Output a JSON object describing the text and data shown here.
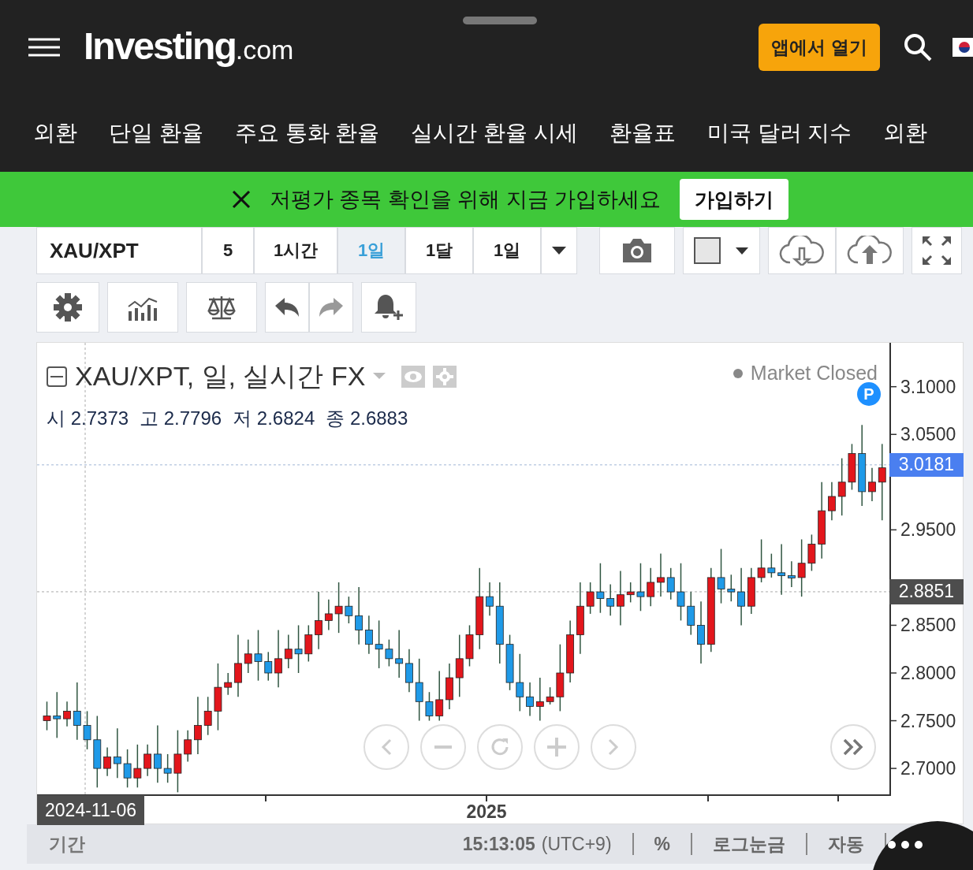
{
  "header": {
    "logo_main": "Investing",
    "logo_suffix": ".com",
    "open_app_button": "앱에서 열기"
  },
  "nav": [
    "외환",
    "단일 환율",
    "주요 통화 환율",
    "실시간 환율 시세",
    "환율표",
    "미국 달러 지수",
    "외환"
  ],
  "banner": {
    "message": "저평가 종목 확인을 위해 지금 가입하세요",
    "signup_button": "가입하기"
  },
  "toolbar": {
    "symbol": "XAU/XPT",
    "intervals": [
      {
        "label": "5",
        "selected": false
      },
      {
        "label": "1시간",
        "selected": false
      },
      {
        "label": "1일",
        "selected": true
      },
      {
        "label": "1달",
        "selected": false
      },
      {
        "label": "1일",
        "selected": false
      }
    ]
  },
  "chart": {
    "title": "XAU/XPT, 일, 실시간 FX",
    "market_status": "Market Closed",
    "p_badge": "P",
    "ohlc_legend": [
      {
        "label": "시",
        "value": "2.7373"
      },
      {
        "label": "고",
        "value": "2.7796"
      },
      {
        "label": "저",
        "value": "2.6824"
      },
      {
        "label": "종",
        "value": "2.6883"
      }
    ],
    "current_price": "3.0181",
    "crosshair_price": "2.8851",
    "crosshair_date": "2024-11-06",
    "time_axis_labels": [
      "2025"
    ],
    "chart_data": {
      "type": "candlestick",
      "ylim": [
        2.672,
        3.146
      ],
      "yticks": [
        {
          "value": 3.1,
          "label": "3.1000"
        },
        {
          "value": 3.05,
          "label": "3.0500"
        },
        {
          "value": 2.95,
          "label": "2.9500"
        },
        {
          "value": 2.85,
          "label": "2.8500"
        },
        {
          "value": 2.8,
          "label": "2.8000"
        },
        {
          "value": 2.75,
          "label": "2.7500"
        },
        {
          "value": 2.7,
          "label": "2.7000"
        }
      ],
      "ref_lines": [
        {
          "axis": "y",
          "value": 3.0181,
          "color": "#9fb5d6"
        },
        {
          "axis": "y",
          "value": 2.8851,
          "color": "#aaaaaa"
        }
      ],
      "ohlc": [
        [
          2.75,
          2.77,
          2.74,
          2.755
        ],
        [
          2.755,
          2.78,
          2.732,
          2.752
        ],
        [
          2.752,
          2.77,
          2.744,
          2.76
        ],
        [
          2.76,
          2.79,
          2.73,
          2.745
        ],
        [
          2.745,
          2.76,
          2.72,
          2.73
        ],
        [
          2.73,
          2.755,
          2.68,
          2.7
        ],
        [
          2.7,
          2.722,
          2.692,
          2.712
        ],
        [
          2.712,
          2.742,
          2.69,
          2.705
        ],
        [
          2.705,
          2.72,
          2.68,
          2.69
        ],
        [
          2.69,
          2.725,
          2.68,
          2.7
        ],
        [
          2.7,
          2.725,
          2.692,
          2.715
        ],
        [
          2.715,
          2.745,
          2.685,
          2.7
        ],
        [
          2.7,
          2.715,
          2.685,
          2.695
        ],
        [
          2.695,
          2.74,
          2.675,
          2.715
        ],
        [
          2.715,
          2.74,
          2.707,
          2.73
        ],
        [
          2.73,
          2.775,
          2.715,
          2.745
        ],
        [
          2.745,
          2.775,
          2.735,
          2.76
        ],
        [
          2.76,
          2.81,
          2.74,
          2.785
        ],
        [
          2.785,
          2.8,
          2.777,
          2.79
        ],
        [
          2.79,
          2.84,
          2.775,
          2.81
        ],
        [
          2.81,
          2.835,
          2.8,
          2.82
        ],
        [
          2.82,
          2.845,
          2.792,
          2.812
        ],
        [
          2.812,
          2.822,
          2.792,
          2.8
        ],
        [
          2.8,
          2.845,
          2.785,
          2.815
        ],
        [
          2.815,
          2.84,
          2.805,
          2.825
        ],
        [
          2.825,
          2.85,
          2.8,
          2.82
        ],
        [
          2.82,
          2.85,
          2.812,
          2.84
        ],
        [
          2.84,
          2.885,
          2.825,
          2.855
        ],
        [
          2.855,
          2.877,
          2.845,
          2.862
        ],
        [
          2.862,
          2.895,
          2.842,
          2.87
        ],
        [
          2.87,
          2.88,
          2.852,
          2.86
        ],
        [
          2.86,
          2.89,
          2.83,
          2.845
        ],
        [
          2.845,
          2.86,
          2.82,
          2.83
        ],
        [
          2.83,
          2.855,
          2.805,
          2.825
        ],
        [
          2.825,
          2.835,
          2.807,
          2.815
        ],
        [
          2.815,
          2.845,
          2.795,
          2.81
        ],
        [
          2.81,
          2.825,
          2.78,
          2.79
        ],
        [
          2.79,
          2.815,
          2.75,
          2.77
        ],
        [
          2.77,
          2.78,
          2.75,
          2.755
        ],
        [
          2.755,
          2.802,
          2.75,
          2.772
        ],
        [
          2.772,
          2.81,
          2.762,
          2.795
        ],
        [
          2.795,
          2.84,
          2.775,
          2.815
        ],
        [
          2.815,
          2.85,
          2.807,
          2.84
        ],
        [
          2.84,
          2.91,
          2.825,
          2.88
        ],
        [
          2.88,
          2.895,
          2.86,
          2.87
        ],
        [
          2.87,
          2.895,
          2.81,
          2.83
        ],
        [
          2.83,
          2.84,
          2.782,
          2.79
        ],
        [
          2.79,
          2.82,
          2.76,
          2.775
        ],
        [
          2.775,
          2.79,
          2.755,
          2.765
        ],
        [
          2.765,
          2.795,
          2.75,
          2.77
        ],
        [
          2.77,
          2.785,
          2.767,
          2.775
        ],
        [
          2.775,
          2.83,
          2.76,
          2.8
        ],
        [
          2.8,
          2.855,
          2.79,
          2.84
        ],
        [
          2.84,
          2.895,
          2.82,
          2.87
        ],
        [
          2.87,
          2.895,
          2.862,
          2.885
        ],
        [
          2.885,
          2.915,
          2.863,
          2.878
        ],
        [
          2.878,
          2.893,
          2.86,
          2.87
        ],
        [
          2.87,
          2.907,
          2.85,
          2.882
        ],
        [
          2.882,
          2.895,
          2.874,
          2.885
        ],
        [
          2.885,
          2.915,
          2.865,
          2.88
        ],
        [
          2.88,
          2.91,
          2.87,
          2.895
        ],
        [
          2.895,
          2.925,
          2.88,
          2.9
        ],
        [
          2.9,
          2.91,
          2.877,
          2.885
        ],
        [
          2.885,
          2.915,
          2.855,
          2.87
        ],
        [
          2.87,
          2.885,
          2.84,
          2.85
        ],
        [
          2.85,
          2.875,
          2.81,
          2.83
        ],
        [
          2.83,
          2.91,
          2.822,
          2.9
        ],
        [
          2.9,
          2.93,
          2.873,
          2.888
        ],
        [
          2.888,
          2.903,
          2.875,
          2.885
        ],
        [
          2.885,
          2.91,
          2.85,
          2.87
        ],
        [
          2.87,
          2.91,
          2.862,
          2.9
        ],
        [
          2.9,
          2.94,
          2.895,
          2.91
        ],
        [
          2.91,
          2.925,
          2.9,
          2.905
        ],
        [
          2.905,
          2.935,
          2.882,
          2.902
        ],
        [
          2.902,
          2.917,
          2.89,
          2.9
        ],
        [
          2.9,
          2.94,
          2.88,
          2.915
        ],
        [
          2.915,
          2.945,
          2.907,
          2.935
        ],
        [
          2.935,
          3.0,
          2.92,
          2.97
        ],
        [
          2.97,
          3.0,
          2.96,
          2.985
        ],
        [
          2.985,
          3.025,
          2.965,
          3.0
        ],
        [
          3.0,
          3.04,
          2.992,
          3.03
        ],
        [
          3.03,
          3.06,
          2.975,
          2.99
        ],
        [
          2.99,
          3.015,
          2.98,
          3.0
        ],
        [
          3.0,
          3.04,
          2.96,
          3.015
        ]
      ]
    }
  },
  "footer": {
    "period_label": "기간",
    "time": "15:13:05",
    "timezone": "(UTC+9)",
    "options": [
      "%",
      "로그눈금",
      "자동"
    ]
  }
}
